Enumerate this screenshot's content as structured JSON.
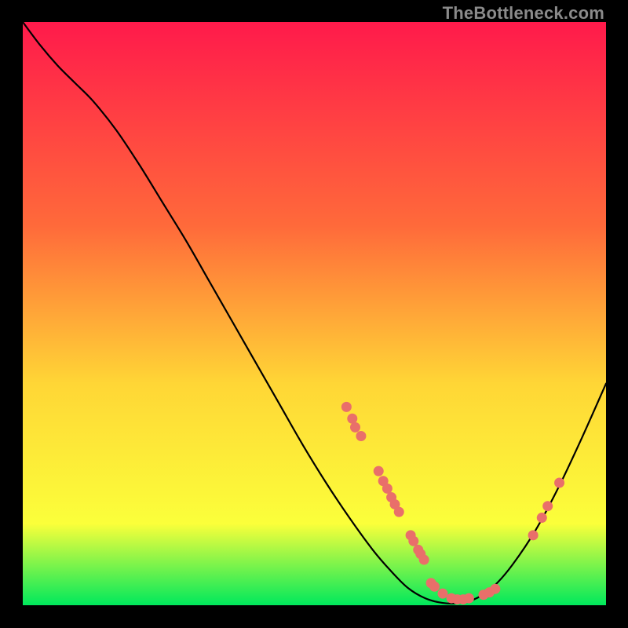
{
  "watermark": "TheBottleneck.com",
  "colors": {
    "gradient_top": "#ff1a4b",
    "gradient_mid1": "#ff6a3a",
    "gradient_mid2": "#ffd636",
    "gradient_mid3": "#fbff3a",
    "gradient_bottom": "#00e85c",
    "curve": "#000000",
    "dot": "#e96f6a",
    "frame_bg": "#000000"
  },
  "chart_data": {
    "type": "line",
    "title": "",
    "xlabel": "",
    "ylabel": "",
    "xlim": [
      0,
      100
    ],
    "ylim": [
      0,
      100
    ],
    "grid": false,
    "legend": false,
    "curve": [
      {
        "x": 0.0,
        "y": 100.0
      },
      {
        "x": 3.0,
        "y": 96.0
      },
      {
        "x": 6.0,
        "y": 92.5
      },
      {
        "x": 9.0,
        "y": 89.5
      },
      {
        "x": 12.0,
        "y": 86.5
      },
      {
        "x": 16.0,
        "y": 81.5
      },
      {
        "x": 20.0,
        "y": 75.5
      },
      {
        "x": 24.0,
        "y": 69.0
      },
      {
        "x": 28.0,
        "y": 62.5
      },
      {
        "x": 32.0,
        "y": 55.5
      },
      {
        "x": 36.0,
        "y": 48.5
      },
      {
        "x": 40.0,
        "y": 41.5
      },
      {
        "x": 44.0,
        "y": 34.5
      },
      {
        "x": 48.0,
        "y": 27.5
      },
      {
        "x": 52.0,
        "y": 21.0
      },
      {
        "x": 56.0,
        "y": 15.0
      },
      {
        "x": 60.0,
        "y": 9.5
      },
      {
        "x": 63.0,
        "y": 6.0
      },
      {
        "x": 66.0,
        "y": 3.0
      },
      {
        "x": 69.0,
        "y": 1.2
      },
      {
        "x": 72.0,
        "y": 0.4
      },
      {
        "x": 75.0,
        "y": 0.4
      },
      {
        "x": 78.0,
        "y": 1.3
      },
      {
        "x": 81.0,
        "y": 3.5
      },
      {
        "x": 84.0,
        "y": 7.0
      },
      {
        "x": 88.0,
        "y": 13.0
      },
      {
        "x": 92.0,
        "y": 20.5
      },
      {
        "x": 96.0,
        "y": 29.0
      },
      {
        "x": 100.0,
        "y": 38.0
      }
    ],
    "scatter_points": [
      {
        "x": 55.5,
        "y": 34.0
      },
      {
        "x": 56.5,
        "y": 32.0
      },
      {
        "x": 57.0,
        "y": 30.5
      },
      {
        "x": 58.0,
        "y": 29.0
      },
      {
        "x": 61.0,
        "y": 23.0
      },
      {
        "x": 61.8,
        "y": 21.3
      },
      {
        "x": 62.5,
        "y": 20.0
      },
      {
        "x": 63.2,
        "y": 18.5
      },
      {
        "x": 63.8,
        "y": 17.3
      },
      {
        "x": 64.5,
        "y": 16.0
      },
      {
        "x": 66.5,
        "y": 12.0
      },
      {
        "x": 67.0,
        "y": 11.0
      },
      {
        "x": 67.8,
        "y": 9.5
      },
      {
        "x": 68.2,
        "y": 8.8
      },
      {
        "x": 68.8,
        "y": 7.8
      },
      {
        "x": 70.0,
        "y": 3.8
      },
      {
        "x": 70.6,
        "y": 3.2
      },
      {
        "x": 72.0,
        "y": 2.0
      },
      {
        "x": 73.5,
        "y": 1.2
      },
      {
        "x": 74.5,
        "y": 1.0
      },
      {
        "x": 75.5,
        "y": 1.0
      },
      {
        "x": 76.5,
        "y": 1.2
      },
      {
        "x": 79.0,
        "y": 1.8
      },
      {
        "x": 80.0,
        "y": 2.2
      },
      {
        "x": 81.0,
        "y": 2.8
      },
      {
        "x": 87.5,
        "y": 12.0
      },
      {
        "x": 89.0,
        "y": 15.0
      },
      {
        "x": 90.0,
        "y": 17.0
      },
      {
        "x": 92.0,
        "y": 21.0
      }
    ]
  }
}
